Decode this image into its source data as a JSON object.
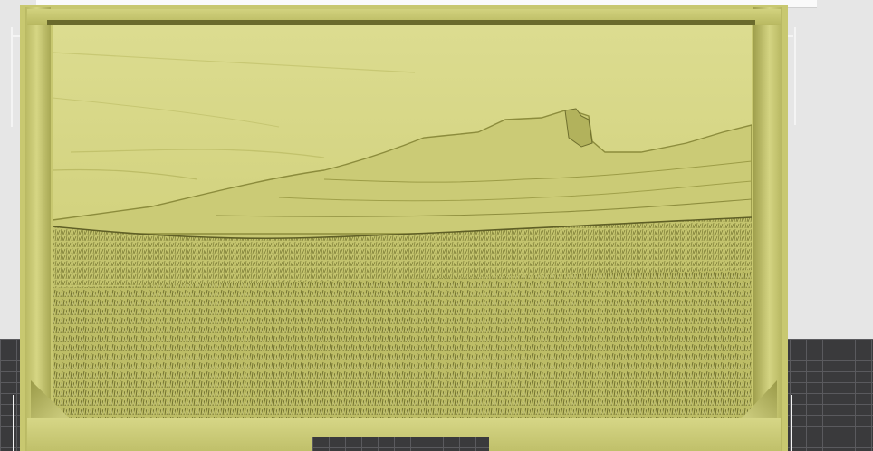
{
  "app": {
    "view": "3d-viewport",
    "object": "lithophane-frame"
  },
  "colors": {
    "background": "#e6e6e6",
    "model": "#d4d482",
    "model_shadow": "#6a6a2c",
    "bed": "#3a3a3c",
    "bed_grid": "#5a5a5e",
    "bounding_lines": "#f4f4f4"
  },
  "icons": {
    "model": "landscape-relief",
    "bed": "print-bed-grid"
  }
}
